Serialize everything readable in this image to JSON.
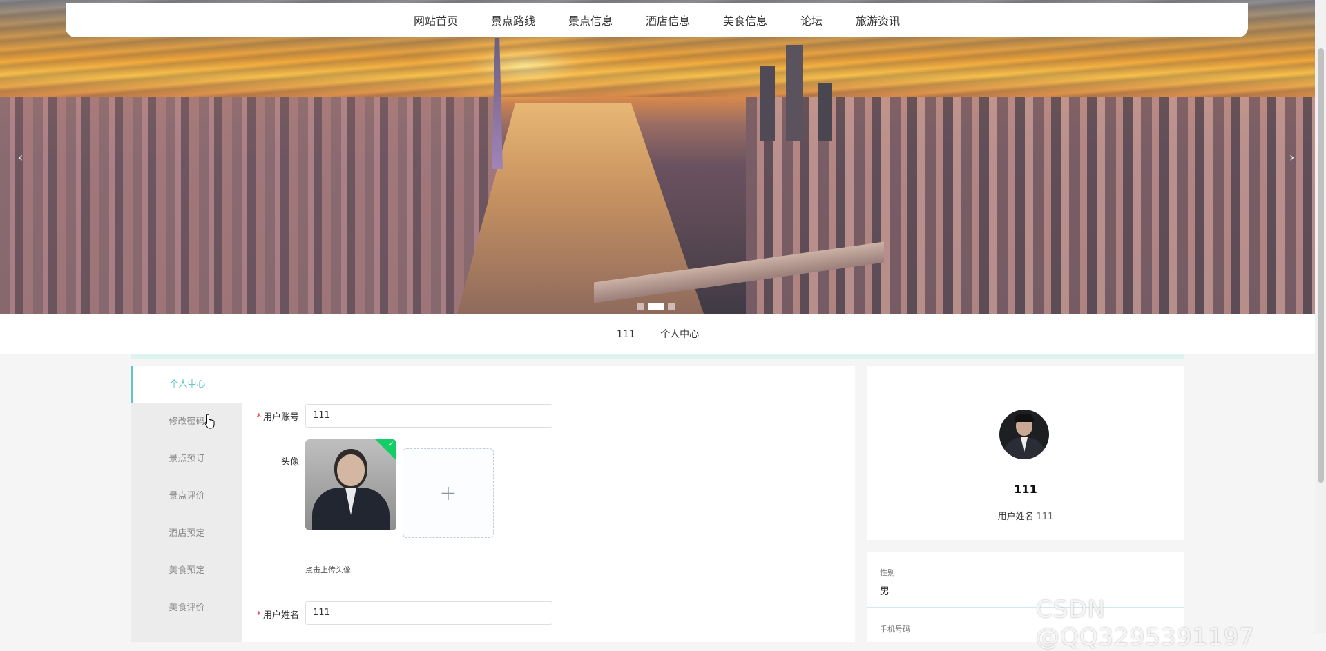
{
  "nav": {
    "items": [
      "网站首页",
      "景点路线",
      "景点信息",
      "酒店信息",
      "美食信息",
      "论坛",
      "旅游资讯"
    ]
  },
  "banner": {
    "prev_icon": "chevron-left-icon",
    "next_icon": "chevron-right-icon",
    "prev_glyph": "‹",
    "next_glyph": "›",
    "slide_count": 3,
    "active_slide": 2
  },
  "breadcrumb": {
    "user": "111",
    "page": "个人中心"
  },
  "side_menu": {
    "items": [
      "个人中心",
      "修改密码",
      "景点预订",
      "景点评价",
      "酒店预定",
      "美食预定",
      "美食评价"
    ],
    "active": "个人中心"
  },
  "form": {
    "account_label": "用户账号",
    "account_value": "111",
    "avatar_label": "头像",
    "upload_glyph": "+",
    "upload_hint": "点击上传头像",
    "name_label": "用户姓名",
    "name_value": "111",
    "required_mark": "*",
    "check_glyph": "✓"
  },
  "profile": {
    "name": "111",
    "name_line_label": "用户姓名",
    "name_line_value": "111"
  },
  "info": {
    "gender_label": "性别",
    "gender_value": "男",
    "phone_label": "手机号码"
  },
  "watermark": "CSDN @QQ3295391197",
  "colors": {
    "accent": "#5fc7bf",
    "required": "#e04343",
    "success": "#13ce66"
  }
}
